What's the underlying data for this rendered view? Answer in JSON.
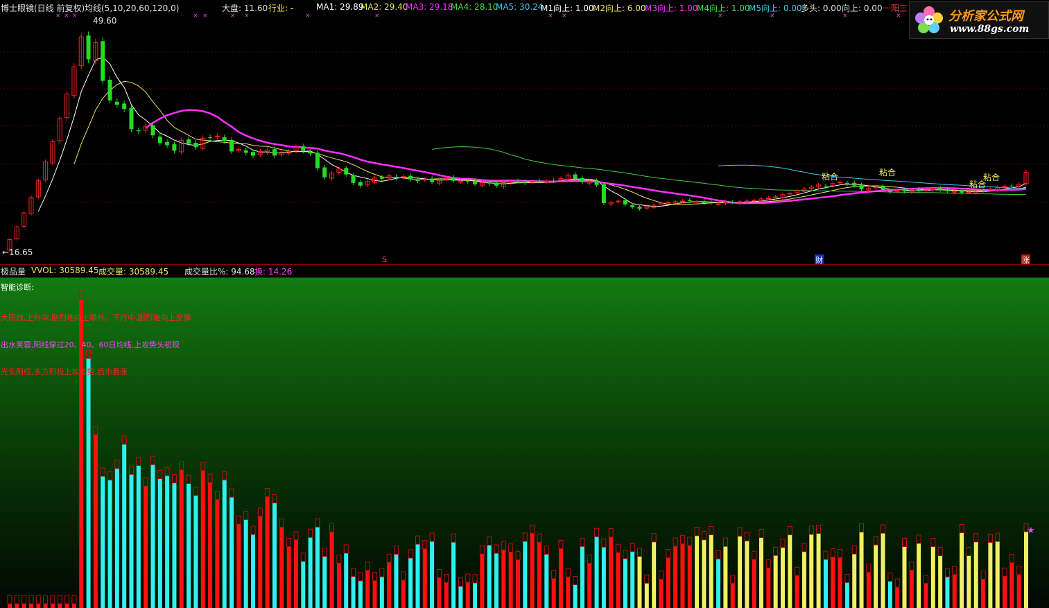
{
  "header": {
    "title": "博士眼镜(日线 前复权)",
    "ma_label": "均线(5,10,20,60,120,0)",
    "market_label": "大盘: 11.60",
    "industry_label": "行业: -",
    "ma1": "MA1: 29.89",
    "ma2": "MA2: 29.40",
    "ma3": "MA3: 29.18",
    "ma4": "MA4: 28.10",
    "ma5": "MA5: 30.24",
    "m1_up": "M1向上: 1.00",
    "m2_up": "M2向上: 6.00",
    "m3_up": "M3向上: 1.00",
    "m4_up": "M4向上: 1.00",
    "m5_up": "M5向上: 0.00",
    "bull": "多头: 0.00",
    "up": "向上: 0.00",
    "one_yang": "一阳三"
  },
  "price_labels": {
    "high": "49.60",
    "low": "←16.65"
  },
  "event_markers": {
    "s_mark": "S",
    "finance_mark": "财",
    "rise_mark": "涨"
  },
  "pattern_labels": [
    "粘合",
    "粘合",
    "粘合",
    "粘合"
  ],
  "volume_header": {
    "indicator": "极品量",
    "vvol": "VVOL: 30589.45",
    "volume": "成交量: 30589.45",
    "ratio": "成交量比%: 94.68",
    "turnover": "换: 14.26"
  },
  "diagnosis": {
    "title": "智能诊断:",
    "line1": "大阳蚀,上升中,剧烈地向上攀升。下行中,剧烈地向上反弹",
    "line2": "出水芙蓉,阳线穿过20、40、60日均线,上攻势头初现",
    "line3": "光头阳线,多方积极上攻态势,后市看涨"
  },
  "logo": {
    "title": "分析家公式网",
    "url": "www.88gs.com"
  },
  "colors": {
    "up": "#ff2020",
    "down": "#22dd22",
    "ma5": "#ffffff",
    "ma10": "#e8e860",
    "ma20": "#ff30ff",
    "ma60": "#40d040",
    "ma120": "#40c8e8",
    "vol_cyan": "#30f0f0",
    "vol_red": "#ff1010",
    "vol_yellow": "#f0f060"
  },
  "chart_data": {
    "type": "candlestick",
    "price_range": [
      16.65,
      49.6
    ],
    "closes": [
      18.3,
      20.1,
      22.1,
      24.3,
      26.7,
      29.4,
      32.3,
      35.6,
      39.1,
      43.0,
      47.3,
      44.1,
      46.5,
      41.0,
      38.2,
      37.6,
      37.0,
      34.1,
      33.8,
      34.5,
      33.2,
      32.1,
      31.8,
      31.0,
      32.5,
      32.0,
      31.5,
      32.8,
      32.9,
      33.1,
      32.4,
      30.9,
      31.2,
      30.7,
      30.3,
      30.9,
      31.1,
      30.3,
      30.8,
      30.9,
      31.5,
      31.0,
      30.6,
      28.5,
      27.2,
      27.8,
      28.4,
      27.6,
      26.4,
      26.0,
      26.6,
      27.1,
      27.0,
      27.4,
      27.1,
      27.3,
      26.9,
      26.7,
      26.9,
      26.5,
      26.9,
      27.1,
      26.7,
      26.6,
      26.6,
      26.2,
      26.4,
      26.3,
      26.0,
      26.4,
      26.6,
      26.7,
      26.4,
      26.6,
      26.7,
      26.6,
      26.7,
      27.0,
      27.5,
      27.0,
      26.5,
      26.6,
      26.1,
      23.5,
      23.6,
      23.8,
      23.3,
      22.9,
      22.7,
      23.0,
      23.2,
      23.5,
      23.6,
      23.7,
      23.8,
      23.8,
      23.7,
      23.5,
      23.5,
      23.4,
      23.6,
      23.6,
      23.7,
      23.8,
      23.9,
      24.1,
      24.2,
      24.4,
      24.7,
      24.9,
      25.3,
      25.5,
      25.8,
      26.1,
      25.9,
      26.3,
      26.5,
      26.3,
      26.0,
      25.5,
      25.6,
      25.8,
      25.4,
      25.1,
      25.3,
      25.2,
      25.4,
      25.2,
      25.5,
      25.6,
      25.4,
      25.2,
      25.2,
      25.0,
      25.1,
      25.2,
      25.3,
      25.5,
      25.7,
      25.9,
      26.0,
      26.2,
      27.9
    ],
    "volume_note": "volume bars (cyan down / red up / yellow highlighted) shown in lower panel"
  }
}
